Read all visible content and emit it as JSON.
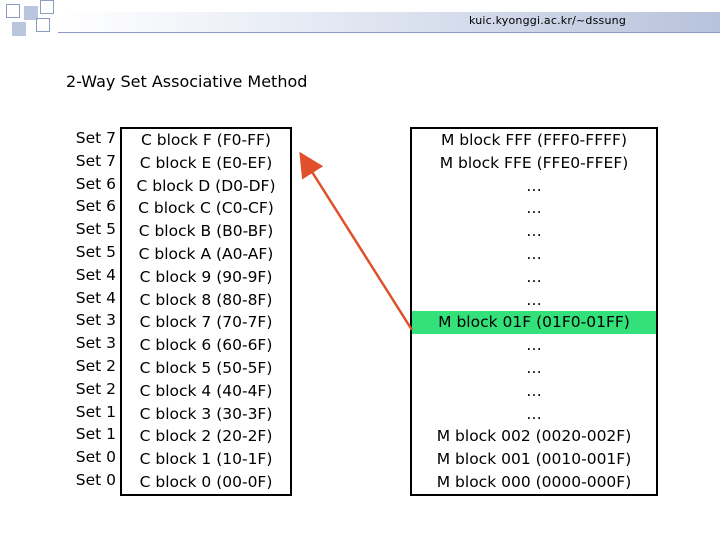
{
  "header": {
    "url": "kuic.kyonggi.ac.kr/~dssung"
  },
  "title": "2-Way Set Associative Method",
  "sets": [
    "Set 7",
    "Set 7",
    "Set 6",
    "Set 6",
    "Set 5",
    "Set 5",
    "Set 4",
    "Set 4",
    "Set 3",
    "Set 3",
    "Set 2",
    "Set 2",
    "Set 1",
    "Set 1",
    "Set 0",
    "Set 0"
  ],
  "cache_blocks": [
    "C block F (F0-FF)",
    "C block E (E0-EF)",
    "C block D (D0-DF)",
    "C block C (C0-CF)",
    "C block B (B0-BF)",
    "C block A (A0-AF)",
    "C block 9 (90-9F)",
    "C block 8 (80-8F)",
    "C block 7 (70-7F)",
    "C block 6 (60-6F)",
    "C block 5 (50-5F)",
    "C block 4 (40-4F)",
    "C block 3 (30-3F)",
    "C block 2 (20-2F)",
    "C block 1 (10-1F)",
    "C block 0 (00-0F)"
  ],
  "memory_blocks": [
    "M block FFF (FFF0-FFFF)",
    "M block FFE (FFE0-FFEF)",
    "…",
    "…",
    "…",
    "…",
    "…",
    "…",
    "M block 01F (01F0-01FF)",
    "…",
    "…",
    "…",
    "…",
    "M block 002 (0020-002F)",
    "M block 001 (0010-001F)",
    "M block 000 (0000-000F)"
  ],
  "highlight_color": "#33e07a",
  "arrow_color": "#e0502a"
}
